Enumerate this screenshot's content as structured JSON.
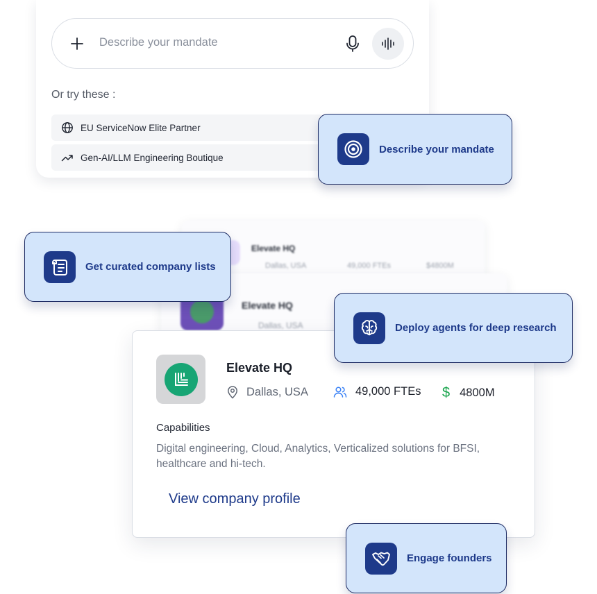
{
  "search": {
    "placeholder": "Describe your mandate",
    "try_label": "Or try these :",
    "suggestions": [
      {
        "label": "EU ServiceNow Elite Partner",
        "icon": "globe-icon"
      },
      {
        "label": "Gen-AI/LLM Engineering Boutique",
        "icon": "trending-up-icon"
      }
    ]
  },
  "callouts": {
    "mandate": {
      "label": "Describe your mandate",
      "icon": "target-icon"
    },
    "lists": {
      "label": "Get curated company lists",
      "icon": "scroll-icon"
    },
    "agents": {
      "label": "Deploy agents for deep research",
      "icon": "brain-icon"
    },
    "founders": {
      "label": "Engage founders",
      "icon": "handshake-icon"
    }
  },
  "ghost_cards": [
    {
      "name": "Elevate HQ",
      "location": "Dallas, USA",
      "ftes": "49,000 FTEs",
      "revenue": "$4800M"
    },
    {
      "name": "Elevate HQ",
      "location": "Dallas, USA"
    }
  ],
  "company": {
    "name": "Elevate HQ",
    "location": "Dallas, USA",
    "ftes": "49,000 FTEs",
    "revenue_symbol": "$",
    "revenue": "4800M",
    "capabilities_heading": "Capabilities",
    "capabilities": "Digital engineering, Cloud, Analytics, Verticalized solutions for BFSI, healthcare and hi-tech.",
    "profile_link": "View company profile"
  },
  "colors": {
    "callout_bg": "#d3e5fb",
    "callout_accent": "#1e3a8a",
    "logo_green": "#17a574",
    "fte_blue": "#3b82f6",
    "revenue_green": "#16a34a"
  }
}
